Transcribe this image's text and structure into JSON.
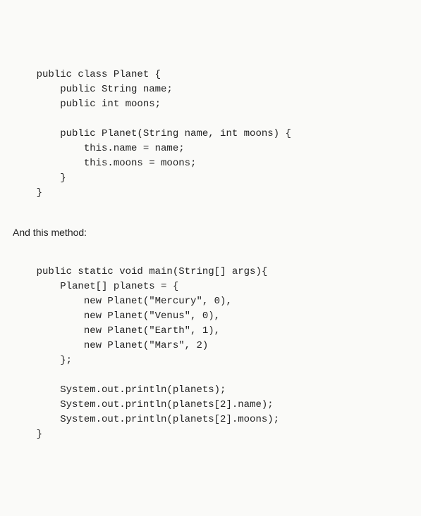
{
  "code1": {
    "l1": "    public class Planet {",
    "l2": "        public String name;",
    "l3": "        public int moons;",
    "l4": "",
    "l5": "        public Planet(String name, int moons) {",
    "l6": "            this.name = name;",
    "l7": "            this.moons = moons;",
    "l8": "        }",
    "l9": "    }"
  },
  "narrative": "And this method:",
  "code2": {
    "l1": "    public static void main(String[] args){",
    "l2": "        Planet[] planets = {",
    "l3": "            new Planet(\"Mercury\", 0),",
    "l4": "            new Planet(\"Venus\", 0),",
    "l5": "            new Planet(\"Earth\", 1),",
    "l6": "            new Planet(\"Mars\", 2)",
    "l7": "        };",
    "l8": "",
    "l9": "        System.out.println(planets);",
    "l10": "        System.out.println(planets[2].name);",
    "l11": "        System.out.println(planets[2].moons);",
    "l12": "    }"
  }
}
